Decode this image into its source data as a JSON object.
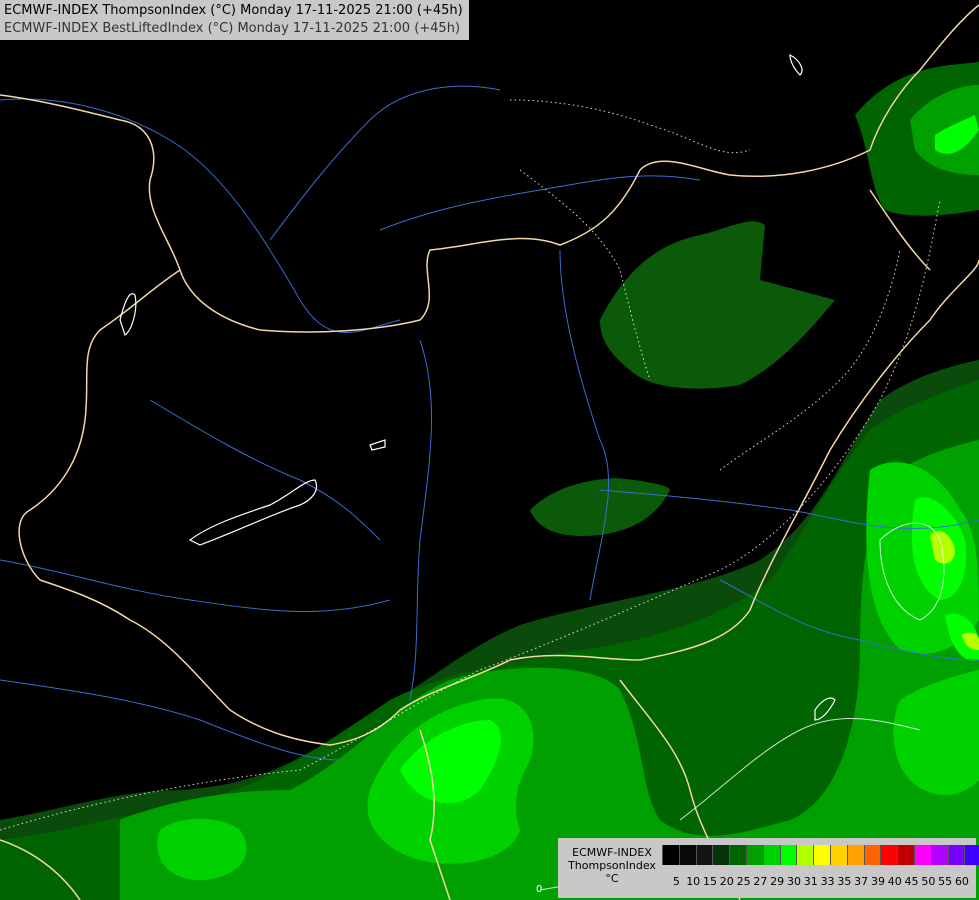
{
  "header": {
    "title_main": "ECMWF-INDEX ThompsonIndex (°C) Monday 17-11-2025 21:00 (+45h)",
    "title_overlay": "ECMWF-INDEX BestLiftedIndex (°C) Monday 17-11-2025 21:00 (+45h)"
  },
  "legend": {
    "model": "ECMWF-INDEX",
    "parameter": "ThompsonIndex",
    "unit": "°C",
    "levels": [
      "5",
      "10",
      "15",
      "20",
      "25",
      "27",
      "29",
      "30",
      "31",
      "33",
      "35",
      "37",
      "39",
      "40",
      "45",
      "50",
      "55",
      "60"
    ],
    "colors": [
      "#000000",
      "#0a0a0a",
      "#141414",
      "#0a320a",
      "#006400",
      "#00a000",
      "#00d200",
      "#00ff00",
      "#b4ff00",
      "#ffff00",
      "#ffd200",
      "#ffa000",
      "#ff6400",
      "#ff0000",
      "#c00000",
      "#ff00ff",
      "#b400ff",
      "#7800ff",
      "#3c00ff",
      "#0000ff"
    ]
  },
  "contour_labels": {
    "lifted_index_zero": "0"
  },
  "colors": {
    "background": "#000000",
    "border": "#f5d6a8",
    "river": "#3a6ccf",
    "lake_outline": "#ffffff"
  }
}
